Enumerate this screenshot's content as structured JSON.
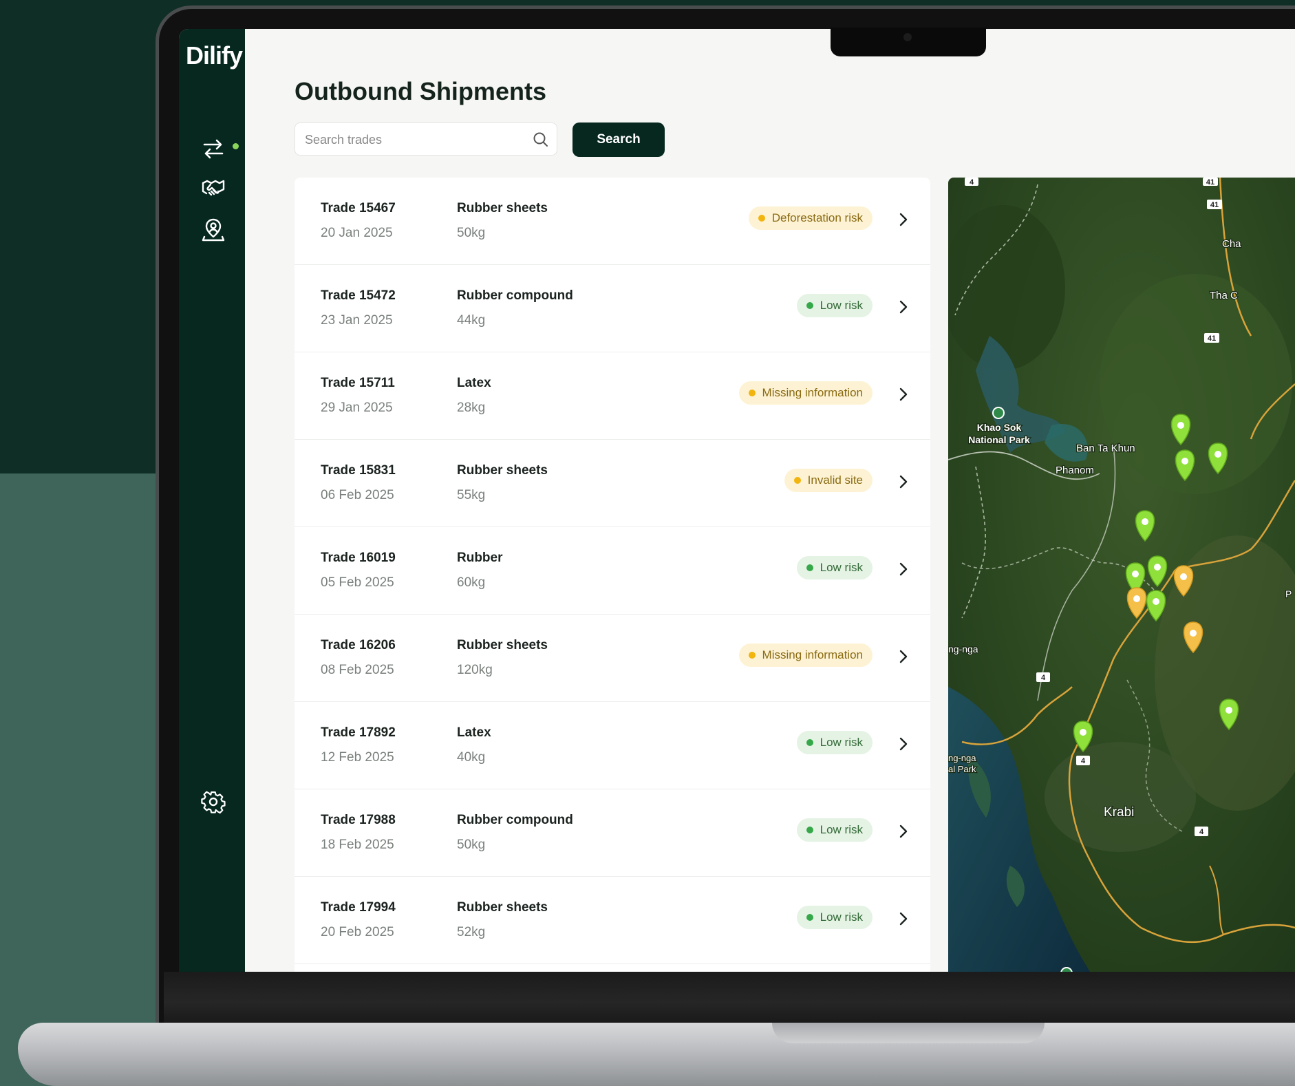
{
  "app": {
    "brand": "Dilify"
  },
  "page": {
    "title": "Outbound Shipments"
  },
  "search": {
    "placeholder": "Search trades",
    "button_label": "Search"
  },
  "nav": {
    "items": [
      "transfers-icon",
      "handshake-icon",
      "location-user-icon",
      "settings-icon"
    ],
    "active": "transfers-icon"
  },
  "colors": {
    "sidebar": "#06281f",
    "accent": "#8bd65a",
    "warning": "#f2b40e",
    "ok": "#36a84a"
  },
  "trades": [
    {
      "id": "Trade 15467",
      "date": "20 Jan 2025",
      "product": "Rubber sheets",
      "qty": "50kg",
      "status": "Deforestation risk",
      "level": "warn"
    },
    {
      "id": "Trade 15472",
      "date": "23 Jan 2025",
      "product": "Rubber compound",
      "qty": "44kg",
      "status": "Low risk",
      "level": "ok"
    },
    {
      "id": "Trade 15711",
      "date": "29 Jan 2025",
      "product": "Latex",
      "qty": "28kg",
      "status": "Missing information",
      "level": "warn"
    },
    {
      "id": "Trade 15831",
      "date": "06 Feb 2025",
      "product": "Rubber sheets",
      "qty": "55kg",
      "status": "Invalid site",
      "level": "warn"
    },
    {
      "id": "Trade 16019",
      "date": "05 Feb 2025",
      "product": "Rubber",
      "qty": "60kg",
      "status": "Low risk",
      "level": "ok"
    },
    {
      "id": "Trade 16206",
      "date": "08 Feb 2025",
      "product": "Rubber sheets",
      "qty": "120kg",
      "status": "Missing information",
      "level": "warn"
    },
    {
      "id": "Trade 17892",
      "date": "12 Feb 2025",
      "product": "Latex",
      "qty": "40kg",
      "status": "Low risk",
      "level": "ok"
    },
    {
      "id": "Trade 17988",
      "date": "18 Feb 2025",
      "product": "Rubber compound",
      "qty": "50kg",
      "status": "Low risk",
      "level": "ok"
    },
    {
      "id": "Trade 17994",
      "date": "20 Feb 2025",
      "product": "Rubber sheets",
      "qty": "52kg",
      "status": "Low risk",
      "level": "ok"
    }
  ],
  "map": {
    "labels": [
      "Khao Sok",
      "National Park",
      "Ban Ta Khun",
      "Phanom",
      "Krabi",
      "Tha C",
      "Cha",
      "ng-nga",
      "ng-nga",
      "al Park",
      "P"
    ],
    "road_shields": [
      "4",
      "41",
      "41",
      "41",
      "4",
      "4",
      "4"
    ]
  }
}
